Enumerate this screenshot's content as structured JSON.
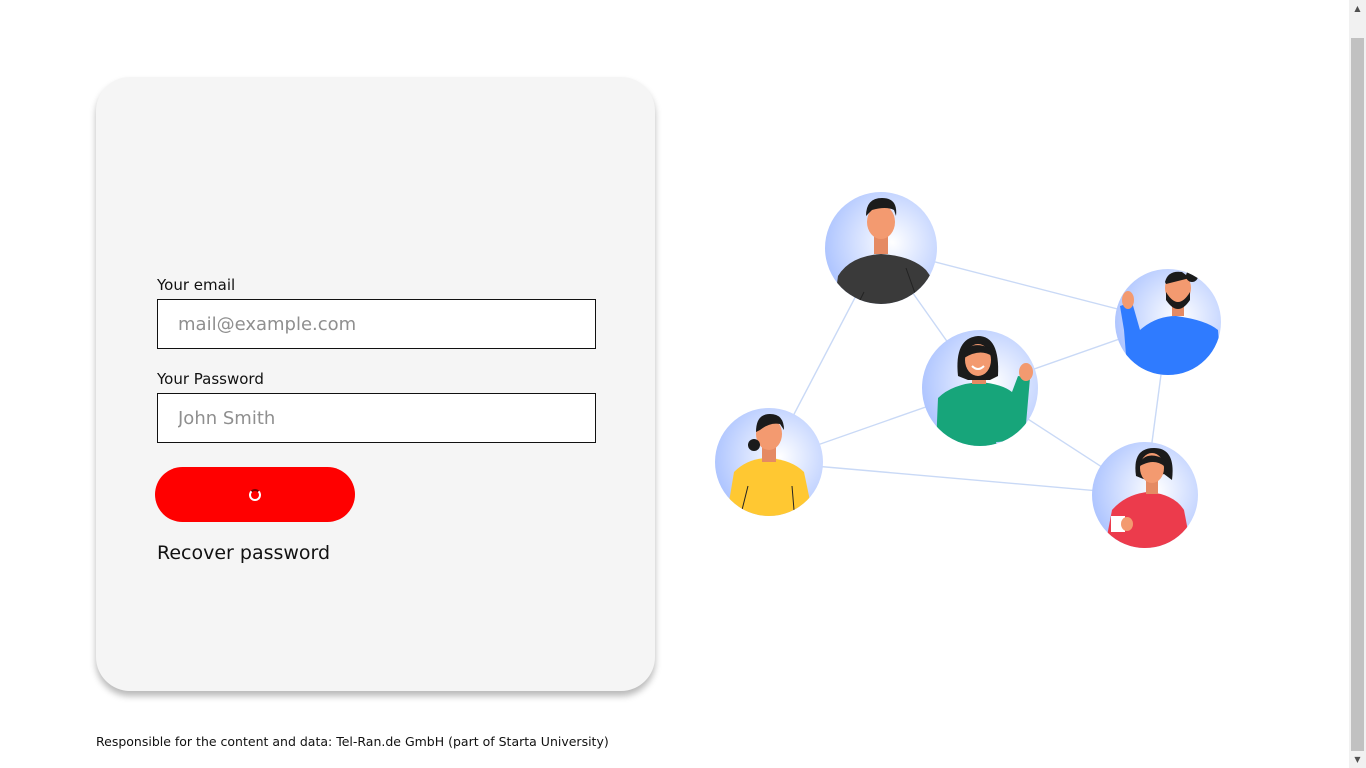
{
  "login": {
    "email_label": "Your email",
    "email_placeholder": "mail@example.com",
    "email_value": "",
    "password_label": "Your Password",
    "password_placeholder": "John Smith",
    "password_value": "",
    "submit_state": "loading",
    "recover_label": "Recover password"
  },
  "footer": {
    "note": "Responsible for the content and data: Tel-Ran.de GmbH (part of Starta University)"
  },
  "colors": {
    "accent": "#ff0000",
    "card_background": "#f5f5f5"
  },
  "icons": {
    "spinner": "loading-spinner-icon",
    "scroll_up": "chevron-up-icon",
    "scroll_down": "chevron-down-icon"
  }
}
